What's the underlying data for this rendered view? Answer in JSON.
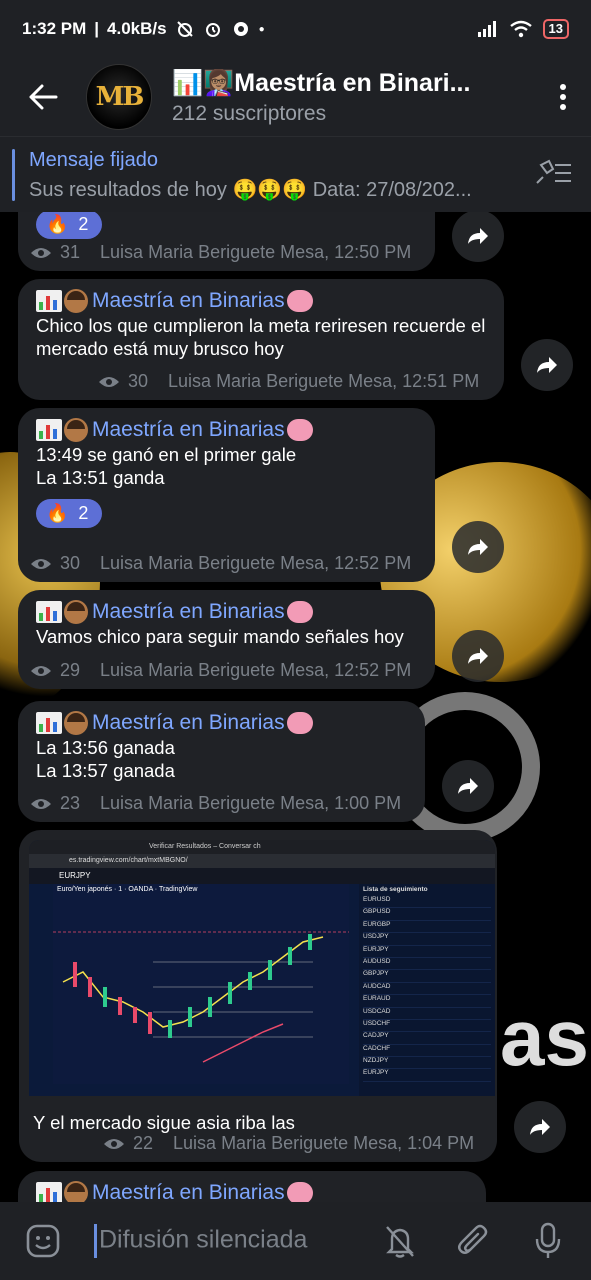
{
  "status_bar": {
    "time": "1:32 PM",
    "network_speed": "4.0kB/s",
    "battery": "13"
  },
  "header": {
    "title": "📊👩🏽‍🏫Maestría en Binari...",
    "subscribers": "212 suscriptores",
    "avatar_text": "MB"
  },
  "pinned": {
    "label": "Mensaje fijado",
    "text": "Sus resultados de hoy 🤑🤑🤑  Data: 27/08/202..."
  },
  "channel_name": "Maestría en Binarias",
  "messages": [
    {
      "reaction_count": "2",
      "views": "31",
      "author_time": "Luisa Maria Beriguete Mesa, 12:50 PM"
    },
    {
      "text": "Chico los que cumplieron la meta reriresen recuerde el mercado está muy brusco hoy",
      "views": "30",
      "author_time": "Luisa Maria Beriguete Mesa, 12:51 PM"
    },
    {
      "line1": "13:49 se ganó en el primer gale",
      "line2": "La 13:51 ganda",
      "reaction_count": "2",
      "views": "30",
      "author_time": "Luisa Maria Beriguete Mesa, 12:52 PM"
    },
    {
      "text": "Vamos chico para seguir mando señales hoy",
      "views": "29",
      "author_time": "Luisa Maria Beriguete Mesa, 12:52 PM"
    },
    {
      "line1": "La 13:56 ganada",
      "line2": "La 13:57 ganada",
      "views": "23",
      "author_time": "Luisa Maria Beriguete Mesa, 1:00 PM"
    },
    {
      "caption": "Y el mercado sigue asia riba las",
      "views": "22",
      "author_time": "Luisa Maria Beriguete Mesa, 1:04 PM"
    }
  ],
  "screenshot": {
    "symbol": "EURJPY",
    "pair_title": "Euro/Yen japonés · 1 · OANDA · TradingView",
    "watchlist_title": "Lista de seguimiento",
    "url": "es.tradingview.com/chart/mxtMBGNO/",
    "tab_title": "Verificar Resultados – Conversar ch",
    "watchlist": [
      "EURUSD",
      "GBPUSD",
      "EURGBP",
      "USDJPY",
      "EURJPY",
      "AUDUSD",
      "GBPJPY",
      "AUDCAD",
      "EURAUD",
      "USDCAD",
      "USDCHF",
      "CADJPY",
      "CADCHF",
      "NZDJPY",
      "EURJPY"
    ]
  },
  "input": {
    "placeholder": "Difusión silenciada"
  }
}
